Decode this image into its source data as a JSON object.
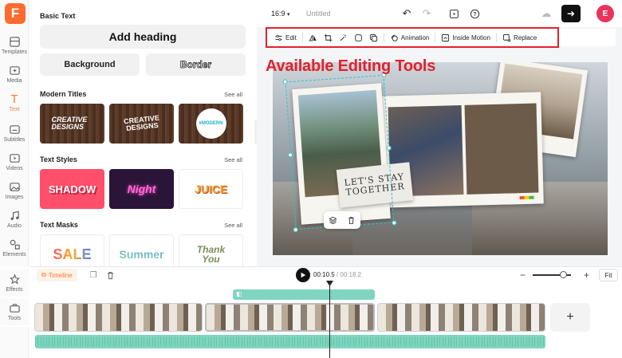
{
  "app": {
    "logo_letter": "F",
    "ratio": "16:9",
    "title": "Untitled",
    "avatar_letter": "E"
  },
  "rail": [
    {
      "label": "Templates"
    },
    {
      "label": "Media"
    },
    {
      "label": "Text"
    },
    {
      "label": "Subtitles"
    },
    {
      "label": "Videos"
    },
    {
      "label": "Images"
    },
    {
      "label": "Audio"
    },
    {
      "label": "Elements"
    },
    {
      "label": "Effects"
    },
    {
      "label": "Tools"
    }
  ],
  "panel": {
    "basic_title": "Basic Text",
    "add_heading": "Add heading",
    "background": "Background",
    "border": "Border",
    "modern_title": "Modern Titles",
    "styles_title": "Text Styles",
    "masks_title": "Text Masks",
    "see_all": "See all",
    "modern": {
      "t1": "CREATIVE DESIGNS",
      "t2": "CREATIVE DESIGNS",
      "t3": "#MODERN"
    },
    "styles": {
      "t1": "SHADOW",
      "t2": "Night",
      "t3": "JUICE"
    },
    "masks": {
      "t1": "SALE",
      "t2": "Summer",
      "t3": "Thank You"
    }
  },
  "toolbar": {
    "edit": "Edit",
    "animation": "Animation",
    "inside_motion": "Inside Motion",
    "replace": "Replace"
  },
  "annotation": "Available Editing Tools",
  "scene": {
    "stay_text": "LET'S STAY TOGETHER"
  },
  "timeline": {
    "tab": "Timeline",
    "current": "00:10.5",
    "separator": " / ",
    "total": "00:18.2",
    "fit": "Fit",
    "zoom_level": 0.8
  },
  "colors": {
    "accent": "#ff7a2f",
    "annotation": "#e0222c",
    "selection": "#2ec4c6",
    "audio": "#7fd5bf"
  }
}
